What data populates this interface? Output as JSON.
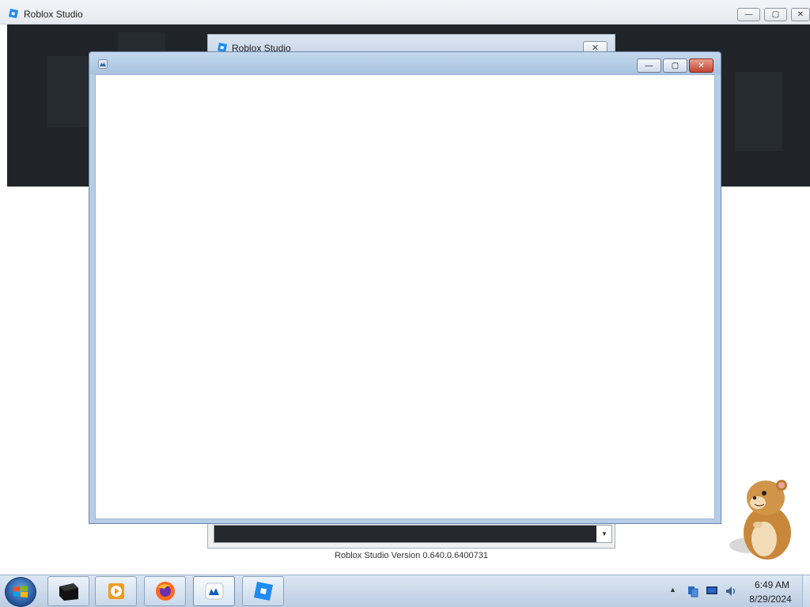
{
  "main_window": {
    "title": "Roblox Studio",
    "buttons": {
      "minimize": "—",
      "maximize": "▢",
      "close": "✕"
    }
  },
  "launcher": {
    "title": "Roblox Studio",
    "close": "✕",
    "combo_arrow": "▼",
    "version": "Roblox Studio Version 0.640.0.6400731"
  },
  "blank_window": {
    "buttons": {
      "minimize": "—",
      "maximize": "▢",
      "close": "✕"
    }
  },
  "taskbar": {
    "items": [
      {
        "name": "terminal",
        "icon": "terminal-icon"
      },
      {
        "name": "media-player",
        "icon": "media-player-icon"
      },
      {
        "name": "firefox",
        "icon": "firefox-icon"
      },
      {
        "name": "roblox-studio-launcher",
        "icon": "roblox-launcher-icon",
        "active": true
      },
      {
        "name": "roblox-studio",
        "icon": "roblox-studio-icon"
      }
    ],
    "tray_expand": "▲",
    "time": "6:49 AM",
    "date": "8/29/2024"
  },
  "colors": {
    "roblox_blue": "#1f8bf0",
    "banner_dark": "#202428",
    "taskbar": "#c8d8ea",
    "close_red": "#c4432f"
  }
}
